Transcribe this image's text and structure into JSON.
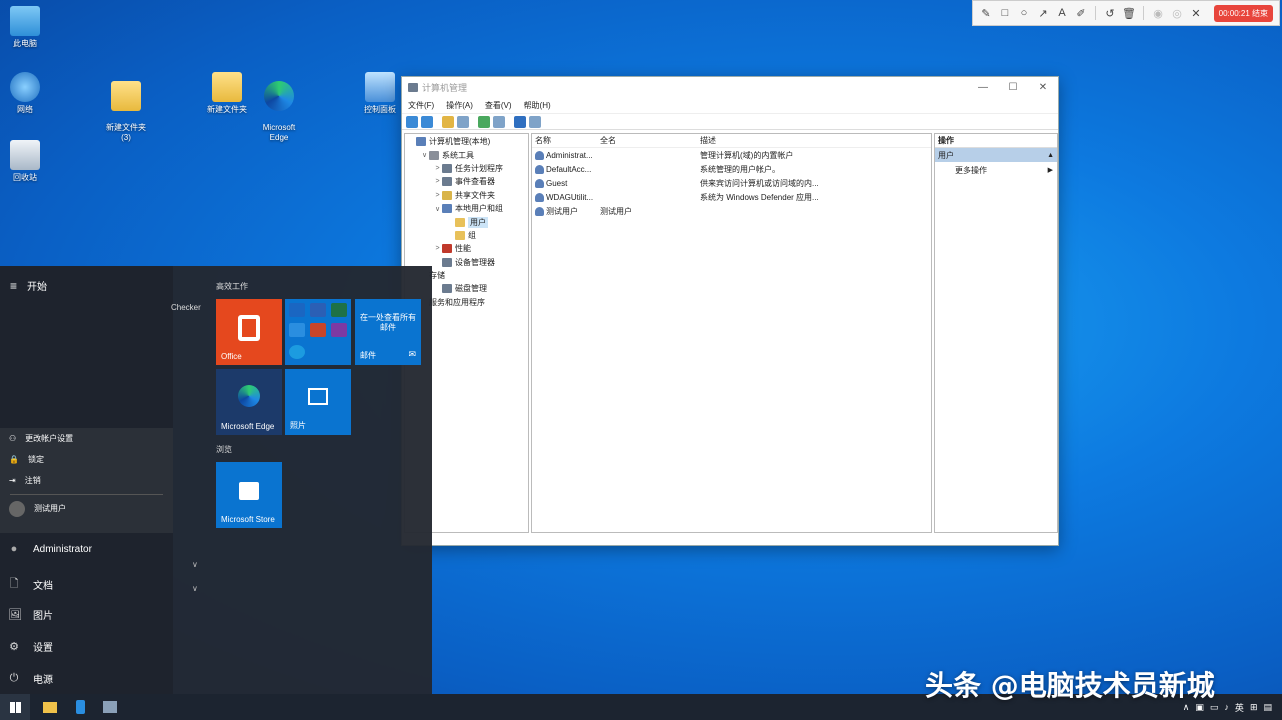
{
  "colors": {
    "accent": "#0b6fcf",
    "office": "#e5481e",
    "tile_blue": "#0a74d0",
    "edge_tile": "#1c3a6a",
    "timer": "#e8453c"
  },
  "desktop": {
    "icons": [
      {
        "label": "此电脑",
        "icon": "computer-icon"
      },
      {
        "label": "网络",
        "icon": "network-icon"
      },
      {
        "label": "新建文件夹\n(3)",
        "icon": "folder-icon"
      },
      {
        "label": "新建文件夹",
        "icon": "folder-icon"
      },
      {
        "label": "Microsoft\nEdge",
        "icon": "edge-icon"
      },
      {
        "label": "控制面板",
        "icon": "control-panel-icon"
      },
      {
        "label": "回收站",
        "icon": "recycle-bin-icon"
      }
    ]
  },
  "recorder": {
    "tools": [
      "pen-icon",
      "rectangle-icon",
      "circle-icon",
      "arrow-icon",
      "text-icon",
      "marker-icon",
      "undo-icon",
      "trash-icon",
      "eye-icon",
      "eye-off-icon",
      "close-icon"
    ],
    "tool_glyphs": [
      "✎",
      "□",
      "○",
      "↗",
      "A",
      "✐",
      "↺",
      "🗑",
      "◉",
      "◎",
      "✕"
    ],
    "timer": "00:00:21 结束"
  },
  "window": {
    "title": "计算机管理",
    "controls": [
      "—",
      "☐",
      "✕"
    ],
    "menu": [
      "文件(F)",
      "操作(A)",
      "查看(V)",
      "帮助(H)"
    ],
    "tree": [
      {
        "label": "计算机管理(本地)",
        "indent": 0,
        "chev": "",
        "color": "#5a7fb8"
      },
      {
        "label": "系统工具",
        "indent": 1,
        "chev": "∨",
        "color": "#8a8f99"
      },
      {
        "label": "任务计划程序",
        "indent": 2,
        "chev": ">",
        "color": "#6b7b8f"
      },
      {
        "label": "事件查看器",
        "indent": 2,
        "chev": ">",
        "color": "#6b7b8f"
      },
      {
        "label": "共享文件夹",
        "indent": 2,
        "chev": ">",
        "color": "#d9b44a"
      },
      {
        "label": "本地用户和组",
        "indent": 2,
        "chev": "∨",
        "color": "#5a7fb8"
      },
      {
        "label": "用户",
        "indent": 3,
        "chev": "",
        "color": "#e8c15a",
        "selected": true
      },
      {
        "label": "组",
        "indent": 3,
        "chev": "",
        "color": "#e8c15a"
      },
      {
        "label": "性能",
        "indent": 2,
        "chev": ">",
        "color": "#c0392b"
      },
      {
        "label": "设备管理器",
        "indent": 2,
        "chev": "",
        "color": "#6b7b8f"
      },
      {
        "label": "存储",
        "indent": 1,
        "chev": "",
        "color": ""
      },
      {
        "label": "磁盘管理",
        "indent": 2,
        "chev": "",
        "color": "#6b7b8f"
      },
      {
        "label": "服务和应用程序",
        "indent": 1,
        "chev": "",
        "color": ""
      }
    ],
    "list_headers": [
      "名称",
      "全名",
      "描述"
    ],
    "users": [
      {
        "name": "Administrat...",
        "fullname": "",
        "desc": "管理计算机(域)的内置帐户"
      },
      {
        "name": "DefaultAcc...",
        "fullname": "",
        "desc": "系统管理的用户帐户。"
      },
      {
        "name": "Guest",
        "fullname": "",
        "desc": "供来宾访问计算机或访问域的内..."
      },
      {
        "name": "WDAGUtilit...",
        "fullname": "",
        "desc": "系统为 Windows Defender 应用..."
      },
      {
        "name": "测试用户",
        "fullname": "测试用户",
        "desc": ""
      }
    ],
    "actions": {
      "header": "操作",
      "selected": "用户",
      "more": "更多操作"
    }
  },
  "start_menu": {
    "header": "开始",
    "checker_text": "Checker",
    "popup": [
      {
        "label": "更改帐户设置",
        "icon": "account-settings-icon",
        "glyph": "⚇"
      },
      {
        "label": "锁定",
        "icon": "lock-icon",
        "glyph": "🔒"
      },
      {
        "label": "注销",
        "icon": "sign-out-icon",
        "glyph": "⇥"
      }
    ],
    "current_user": "测试用户",
    "rail": [
      {
        "label": "Administrator",
        "icon": "user-avatar-icon",
        "glyph": "●"
      },
      {
        "label": "文档",
        "icon": "document-icon",
        "glyph": "🗋"
      },
      {
        "label": "图片",
        "icon": "pictures-icon",
        "glyph": "🖼"
      },
      {
        "label": "设置",
        "icon": "settings-icon",
        "glyph": "⚙"
      },
      {
        "label": "电源",
        "icon": "power-icon",
        "glyph": "⏻"
      }
    ],
    "groups": {
      "productivity": "高效工作",
      "browse": "浏览"
    },
    "tiles": {
      "office": "Office",
      "mail_text": "在一处查看所有\n邮件",
      "mail": "邮件",
      "edge": "Microsoft Edge",
      "photos": "照片",
      "store": "Microsoft Store"
    }
  },
  "taskbar": {
    "apps": [
      "windows-start-icon",
      "file-explorer-icon",
      "phone-app-icon",
      "computer-management-icon"
    ],
    "tray_lang": "英"
  },
  "watermark": "头条 @电脑技术员新城"
}
